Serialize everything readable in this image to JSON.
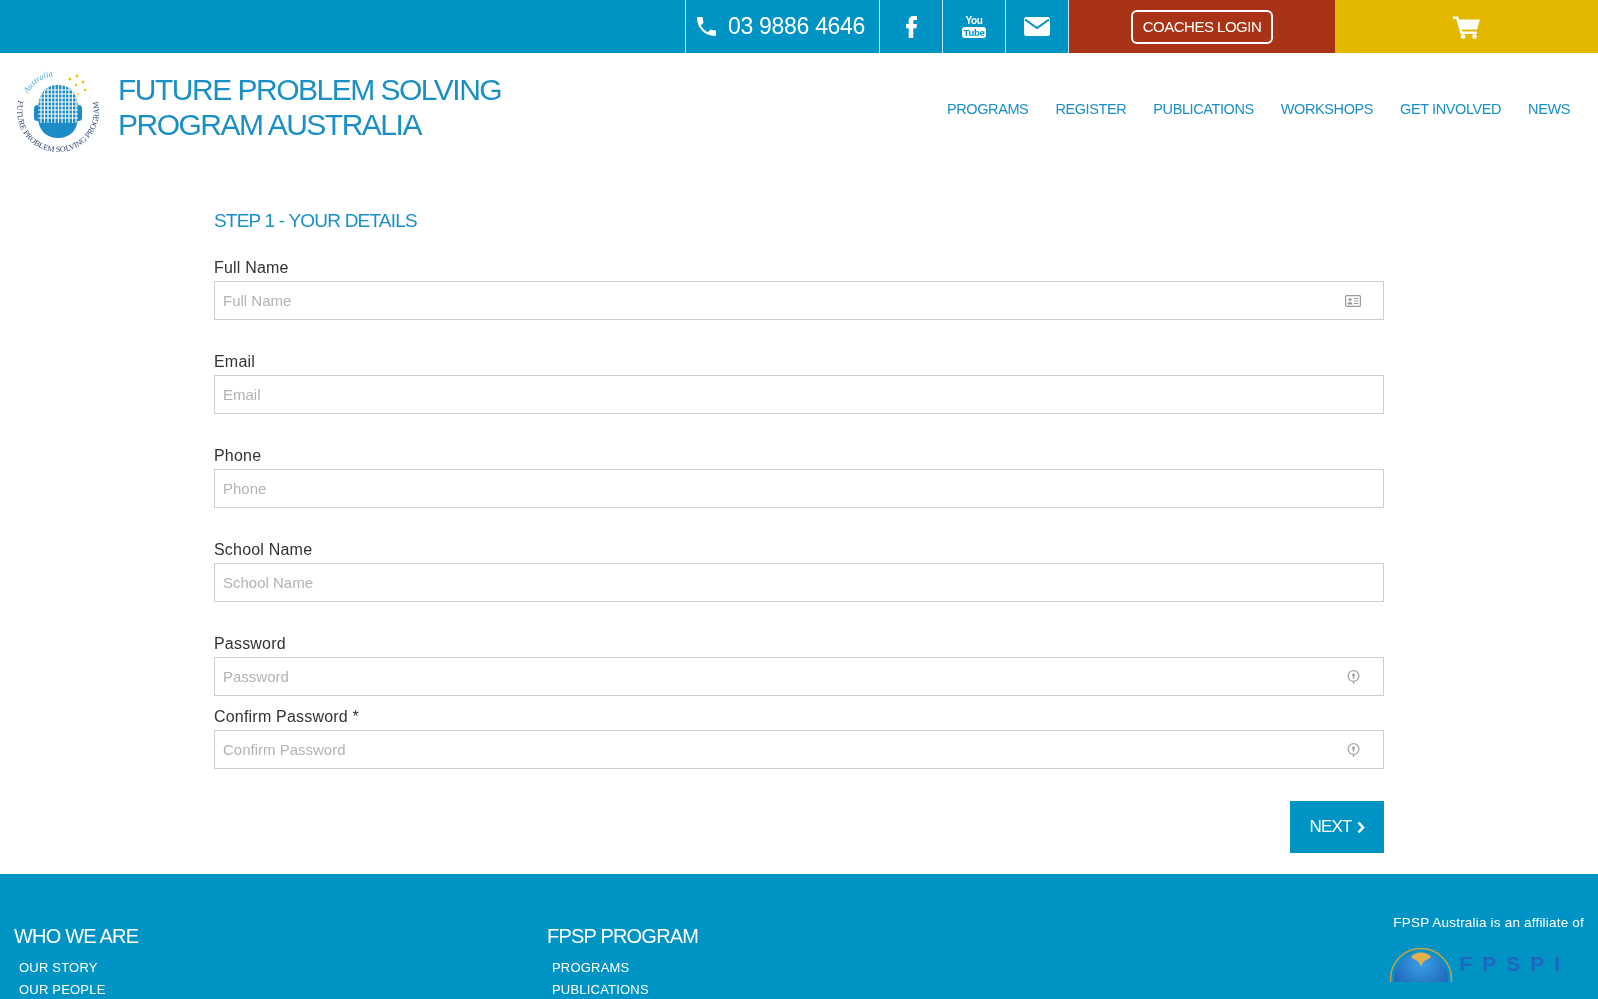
{
  "top_bar": {
    "phone": "03 9886 4646",
    "social_links": [
      {
        "kind": "facebook"
      },
      {
        "kind": "youtube",
        "text": "You",
        "badge": "Tube"
      },
      {
        "kind": "email"
      }
    ],
    "login_button": "COACHES LOGIN"
  },
  "header": {
    "logo": {
      "arc_text": "Australia",
      "ring_text": "FUTURE PROBLEM SOLVING PROGRAM"
    },
    "site_title": [
      "FUTURE PROBLEM SOLVING",
      "PROGRAM AUSTRALIA"
    ],
    "nav": [
      "PROGRAMS",
      "REGISTER",
      "PUBLICATIONS",
      "WORKSHOPS",
      "GET INVOLVED",
      "NEWS"
    ]
  },
  "form": {
    "heading": "STEP 1 - YOUR DETAILS",
    "fields": [
      {
        "label": "Full Name",
        "placeholder": "Full Name",
        "kind": "name"
      },
      {
        "label": "Email",
        "placeholder": "Email",
        "kind": "email"
      },
      {
        "label": "Phone",
        "placeholder": "Phone",
        "kind": "phone"
      },
      {
        "label": "School Name",
        "placeholder": "School Name",
        "kind": "text"
      },
      {
        "label": "Password",
        "placeholder": "Password",
        "kind": "password"
      },
      {
        "label": "Confirm Password *",
        "placeholder": "Confirm Password",
        "kind": "password"
      }
    ],
    "next_button": "NEXT"
  },
  "footer": {
    "columns": [
      {
        "heading": "WHO WE ARE",
        "links": [
          "OUR STORY",
          "OUR PEOPLE"
        ]
      },
      {
        "heading": "FPSP PROGRAM",
        "links": [
          "PROGRAMS",
          "PUBLICATIONS"
        ]
      }
    ],
    "affiliate": {
      "text": "FPSP Australia is an affiliate of",
      "logo_text": "FPSPI"
    }
  }
}
